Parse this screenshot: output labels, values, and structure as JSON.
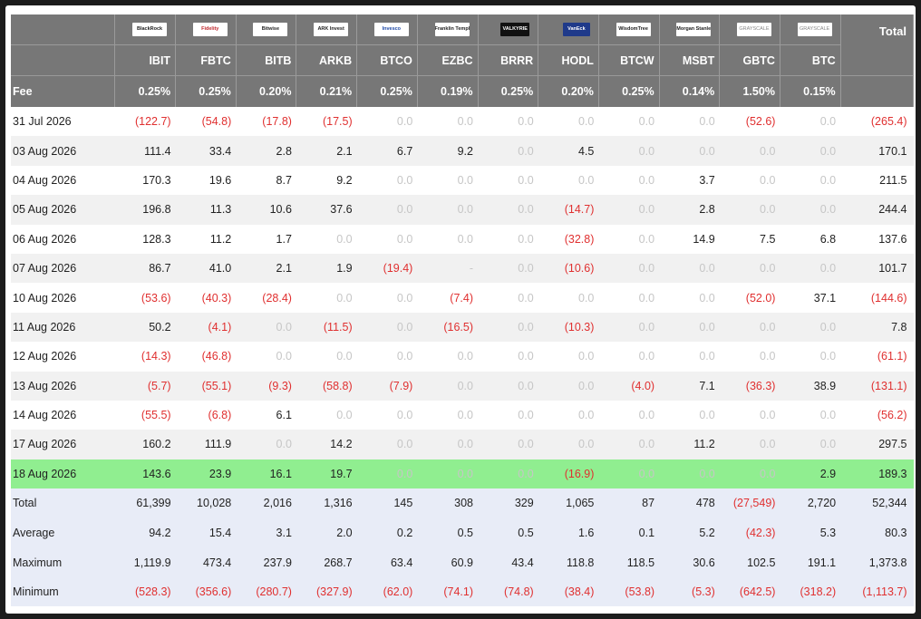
{
  "header": {
    "logos": [
      "BlackRock",
      "Fidelity",
      "Bitwise",
      "ARK Invest",
      "Invesco",
      "Franklin Templeton",
      "VALKYRIE",
      "VanEck",
      "WisdomTree",
      "Morgan Stanley",
      "GRAYSCALE",
      "GRAYSCALE"
    ],
    "tickers": [
      "IBIT",
      "FBTC",
      "BITB",
      "ARKB",
      "BTCO",
      "EZBC",
      "BRRR",
      "HODL",
      "BTCW",
      "MSBT",
      "GBTC",
      "BTC"
    ],
    "total_label": "Total",
    "fee_label": "Fee",
    "fees": [
      "0.25%",
      "0.25%",
      "0.20%",
      "0.21%",
      "0.25%",
      "0.19%",
      "0.25%",
      "0.20%",
      "0.25%",
      "0.14%",
      "1.50%",
      "0.15%"
    ]
  },
  "rows": [
    {
      "date": "31 Jul 2026",
      "values": [
        "(122.7)",
        "(54.8)",
        "(17.8)",
        "(17.5)",
        "0.0",
        "0.0",
        "0.0",
        "0.0",
        "0.0",
        "0.0",
        "(52.6)",
        "0.0"
      ],
      "total": "(265.4)"
    },
    {
      "date": "03 Aug 2026",
      "values": [
        "111.4",
        "33.4",
        "2.8",
        "2.1",
        "6.7",
        "9.2",
        "0.0",
        "4.5",
        "0.0",
        "0.0",
        "0.0",
        "0.0"
      ],
      "total": "170.1"
    },
    {
      "date": "04 Aug 2026",
      "values": [
        "170.3",
        "19.6",
        "8.7",
        "9.2",
        "0.0",
        "0.0",
        "0.0",
        "0.0",
        "0.0",
        "3.7",
        "0.0",
        "0.0"
      ],
      "total": "211.5"
    },
    {
      "date": "05 Aug 2026",
      "values": [
        "196.8",
        "11.3",
        "10.6",
        "37.6",
        "0.0",
        "0.0",
        "0.0",
        "(14.7)",
        "0.0",
        "2.8",
        "0.0",
        "0.0"
      ],
      "total": "244.4"
    },
    {
      "date": "06 Aug 2026",
      "values": [
        "128.3",
        "11.2",
        "1.7",
        "0.0",
        "0.0",
        "0.0",
        "0.0",
        "(32.8)",
        "0.0",
        "14.9",
        "7.5",
        "6.8"
      ],
      "total": "137.6"
    },
    {
      "date": "07 Aug 2026",
      "values": [
        "86.7",
        "41.0",
        "2.1",
        "1.9",
        "(19.4)",
        "-",
        "0.0",
        "(10.6)",
        "0.0",
        "0.0",
        "0.0",
        "0.0"
      ],
      "total": "101.7"
    },
    {
      "date": "10 Aug 2026",
      "values": [
        "(53.6)",
        "(40.3)",
        "(28.4)",
        "0.0",
        "0.0",
        "(7.4)",
        "0.0",
        "0.0",
        "0.0",
        "0.0",
        "(52.0)",
        "37.1"
      ],
      "total": "(144.6)"
    },
    {
      "date": "11 Aug 2026",
      "values": [
        "50.2",
        "(4.1)",
        "0.0",
        "(11.5)",
        "0.0",
        "(16.5)",
        "0.0",
        "(10.3)",
        "0.0",
        "0.0",
        "0.0",
        "0.0"
      ],
      "total": "7.8"
    },
    {
      "date": "12 Aug 2026",
      "values": [
        "(14.3)",
        "(46.8)",
        "0.0",
        "0.0",
        "0.0",
        "0.0",
        "0.0",
        "0.0",
        "0.0",
        "0.0",
        "0.0",
        "0.0"
      ],
      "total": "(61.1)"
    },
    {
      "date": "13 Aug 2026",
      "values": [
        "(5.7)",
        "(55.1)",
        "(9.3)",
        "(58.8)",
        "(7.9)",
        "0.0",
        "0.0",
        "0.0",
        "(4.0)",
        "7.1",
        "(36.3)",
        "38.9"
      ],
      "total": "(131.1)"
    },
    {
      "date": "14 Aug 2026",
      "values": [
        "(55.5)",
        "(6.8)",
        "6.1",
        "0.0",
        "0.0",
        "0.0",
        "0.0",
        "0.0",
        "0.0",
        "0.0",
        "0.0",
        "0.0"
      ],
      "total": "(56.2)"
    },
    {
      "date": "17 Aug 2026",
      "values": [
        "160.2",
        "111.9",
        "0.0",
        "14.2",
        "0.0",
        "0.0",
        "0.0",
        "0.0",
        "0.0",
        "11.2",
        "0.0",
        "0.0"
      ],
      "total": "297.5"
    },
    {
      "date": "18 Aug 2026",
      "values": [
        "143.6",
        "23.9",
        "16.1",
        "19.7",
        "0.0",
        "0.0",
        "0.0",
        "(16.9)",
        "0.0",
        "0.0",
        "0.0",
        "2.9"
      ],
      "total": "189.3",
      "highlight": true
    }
  ],
  "summary": [
    {
      "label": "Total",
      "values": [
        "61,399",
        "10,028",
        "2,016",
        "1,316",
        "145",
        "308",
        "329",
        "1,065",
        "87",
        "478",
        "(27,549)",
        "2,720"
      ],
      "total": "52,344"
    },
    {
      "label": "Average",
      "values": [
        "94.2",
        "15.4",
        "3.1",
        "2.0",
        "0.2",
        "0.5",
        "0.5",
        "1.6",
        "0.1",
        "5.2",
        "(42.3)",
        "5.3"
      ],
      "total": "80.3"
    },
    {
      "label": "Maximum",
      "values": [
        "1,119.9",
        "473.4",
        "237.9",
        "268.7",
        "63.4",
        "60.9",
        "43.4",
        "118.8",
        "118.5",
        "30.6",
        "102.5",
        "191.1"
      ],
      "total": "1,373.8"
    },
    {
      "label": "Minimum",
      "values": [
        "(528.3)",
        "(356.6)",
        "(280.7)",
        "(327.9)",
        "(62.0)",
        "(74.1)",
        "(74.8)",
        "(38.4)",
        "(53.8)",
        "(5.3)",
        "(642.5)",
        "(318.2)"
      ],
      "total": "(1,113.7)"
    }
  ],
  "colors": {
    "header_bg": "#777777",
    "highlight_row": "#90ee90",
    "negative_text": "#e03030",
    "zero_text": "#c6c6c6",
    "summary_bg": "#e8ecf7"
  }
}
